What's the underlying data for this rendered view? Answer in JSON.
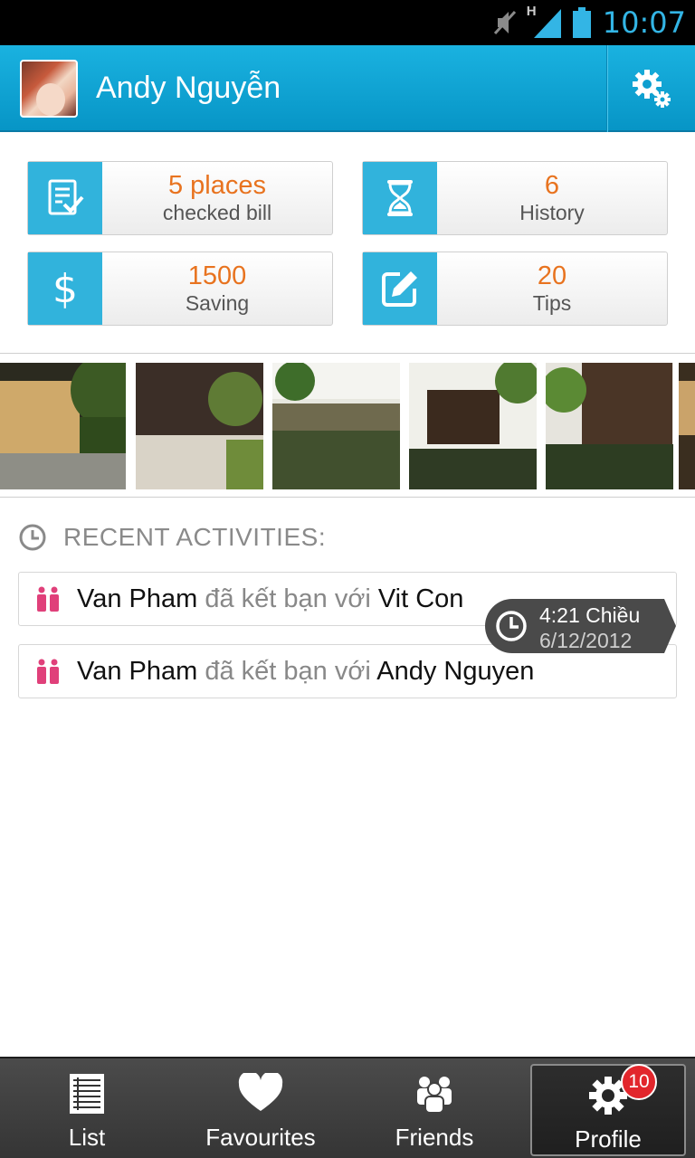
{
  "status_bar": {
    "time": "10:07",
    "network_label": "H"
  },
  "header": {
    "user_name": "Andy Nguyễn"
  },
  "stats": [
    {
      "value": "5 places",
      "label": "checked bill",
      "icon": "checklist-icon"
    },
    {
      "value": "6",
      "label": "History",
      "icon": "hourglass-icon"
    },
    {
      "value": "1500",
      "label": "Saving",
      "icon": "dollar-icon"
    },
    {
      "value": "20",
      "label": "Tips",
      "icon": "edit-icon"
    }
  ],
  "recent": {
    "title": "RECENT ACTIVITIES:",
    "items": [
      {
        "actor": "Van Pham",
        "verb": "đã kết bạn với",
        "target": "Vit Con"
      },
      {
        "actor": "Van Pham",
        "verb": "đã kết bạn với",
        "target": "Andy Nguyen"
      }
    ],
    "timestamp": {
      "time": "4:21 Chiều",
      "date": "6/12/2012"
    }
  },
  "nav": {
    "tabs": [
      {
        "label": "List",
        "icon": "list-icon"
      },
      {
        "label": "Favourites",
        "icon": "heart-icon"
      },
      {
        "label": "Friends",
        "icon": "friends-icon"
      },
      {
        "label": "Profile",
        "icon": "gear-icon",
        "badge": "10"
      }
    ],
    "active": "Profile"
  },
  "colors": {
    "header": "#0e9fd0",
    "card_icon_bg": "#31b3dc",
    "accent_orange": "#e8731f",
    "people_icon": "#e0407a",
    "badge_red": "#e2262c"
  }
}
